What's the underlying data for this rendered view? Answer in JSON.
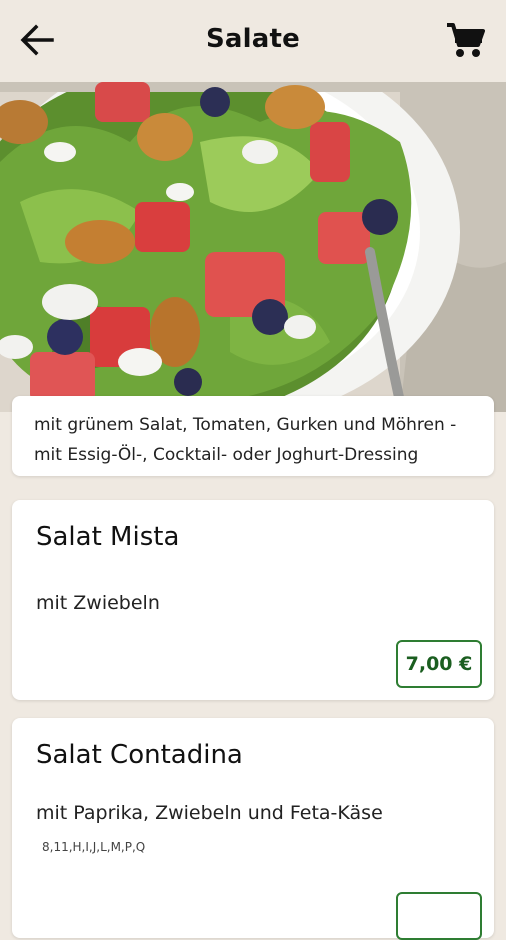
{
  "header": {
    "title": "Salate",
    "back_icon": "arrow-left-icon",
    "cart_icon": "shopping-cart-icon"
  },
  "category": {
    "description": "mit grünem Salat, Tomaten, Gurken und Möhren - mit Essig-Öl-, Cocktail- oder Joghurt-Dressing"
  },
  "items": [
    {
      "name": "Salat Mista",
      "description": "mit Zwiebeln",
      "allergens": "",
      "price": "7,00 €"
    },
    {
      "name": "Salat Contadina",
      "description": "mit Paprika, Zwiebeln und Feta-Käse",
      "allergens": "8,11,H,I,J,L,M,P,Q",
      "price": ""
    }
  ],
  "colors": {
    "background": "#efe9e1",
    "price_border": "#2e7d32"
  }
}
